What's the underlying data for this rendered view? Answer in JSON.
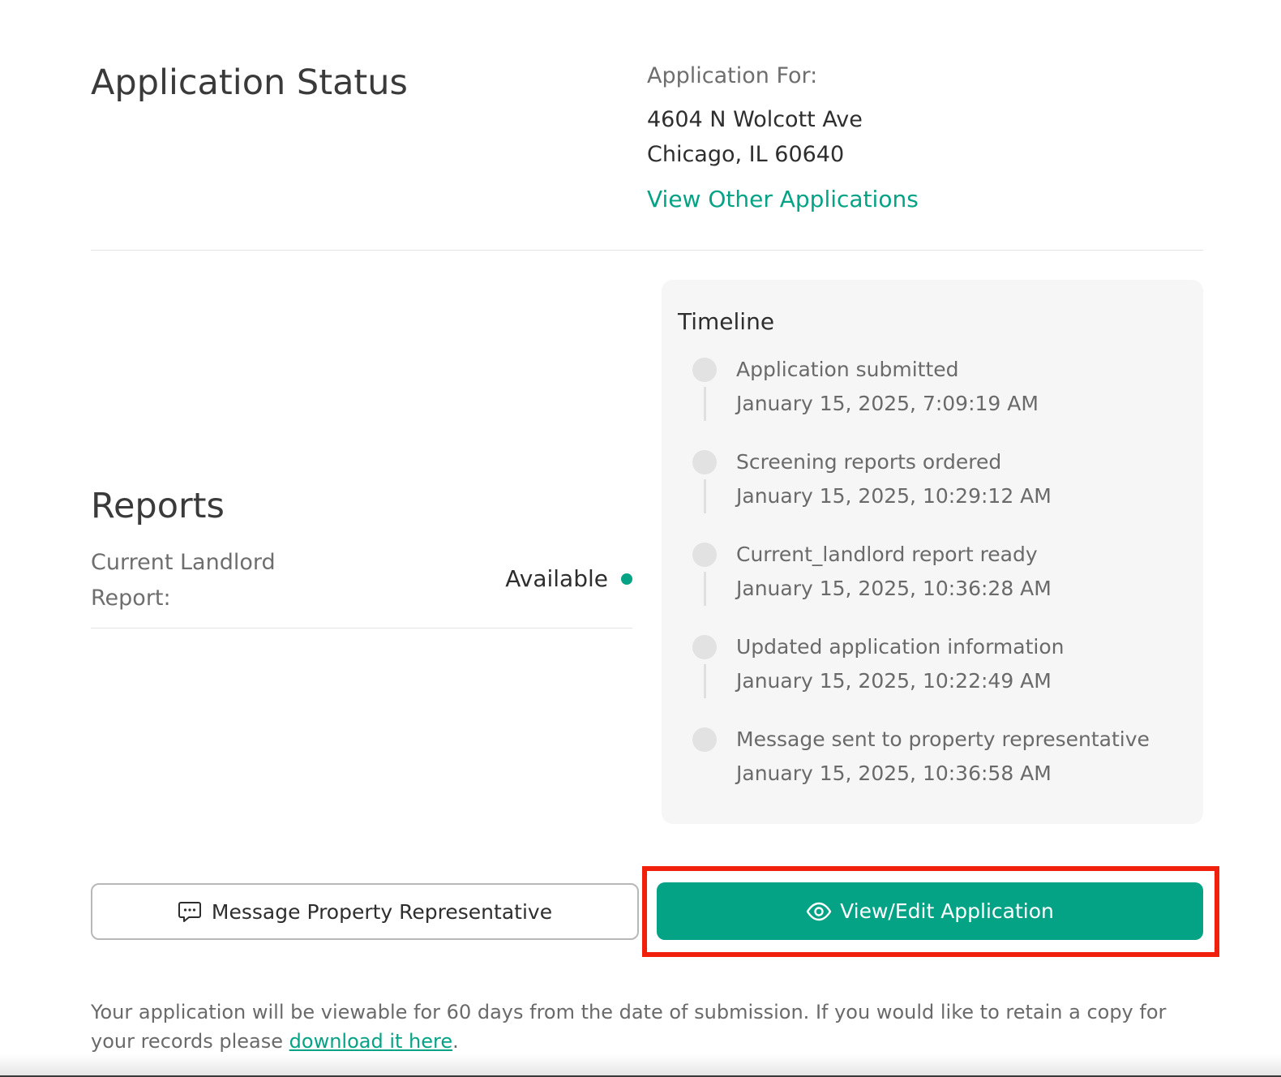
{
  "header": {
    "title": "Application Status"
  },
  "application_for": {
    "label": "Application For:",
    "address_line1": "4604 N Wolcott Ave",
    "address_line2": "Chicago, IL 60640",
    "view_other_label": "View Other Applications"
  },
  "reports": {
    "title": "Reports",
    "items": [
      {
        "label": "Current Landlord Report:",
        "status": "Available",
        "status_color": "#05a386"
      }
    ]
  },
  "timeline": {
    "title": "Timeline",
    "events": [
      {
        "event": "Application submitted",
        "date": "January 15, 2025, 7:09:19 AM"
      },
      {
        "event": "Screening reports ordered",
        "date": "January 15, 2025, 10:29:12 AM"
      },
      {
        "event": "Current_landlord report ready",
        "date": "January 15, 2025, 10:36:28 AM"
      },
      {
        "event": "Updated application information",
        "date": "January 15, 2025, 10:22:49 AM"
      },
      {
        "event": "Message sent to property representative",
        "date": "January 15, 2025, 10:36:58 AM"
      }
    ]
  },
  "actions": {
    "message_label": "Message Property Representative",
    "message_icon": "chat-bubble-icon",
    "view_edit_label": "View/Edit Application",
    "view_edit_icon": "eye-icon",
    "accent_color": "#05a386",
    "highlight_color": "#f0200c"
  },
  "footer": {
    "note_text": "Your application will be viewable for 60 days from the date of submission. If you would like to retain a copy for your records please ",
    "download_link": "download it here",
    "note_end": "."
  }
}
